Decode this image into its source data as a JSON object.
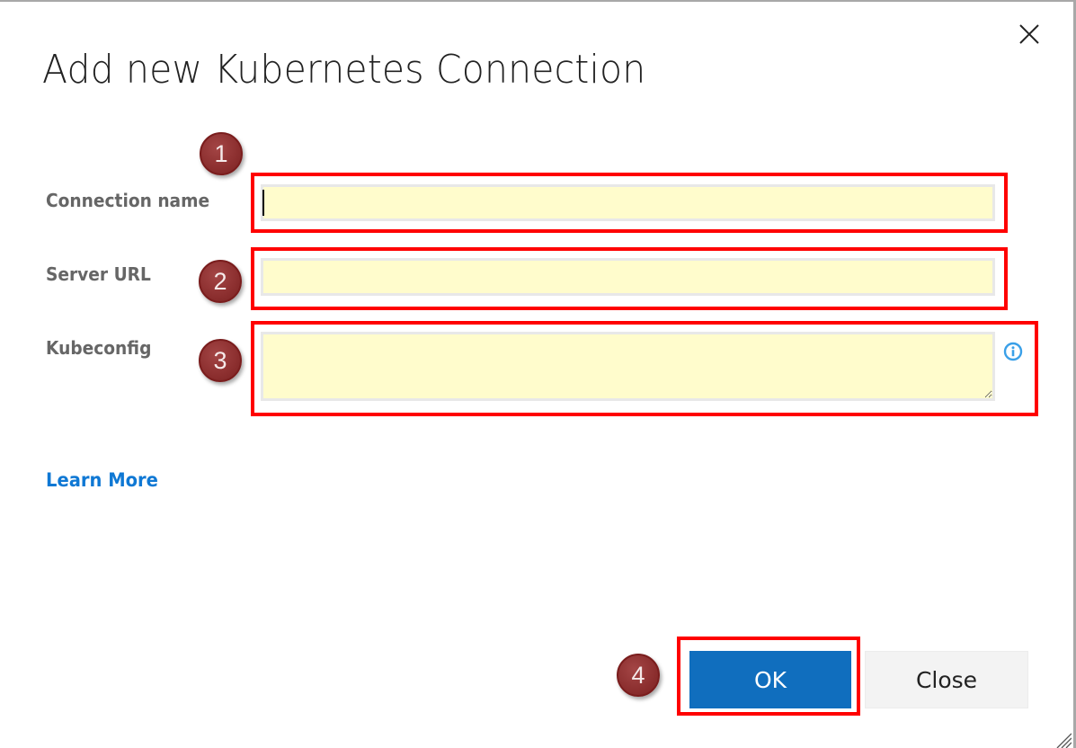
{
  "dialog": {
    "title": "Add new Kubernetes Connection",
    "close_icon": "close-x-icon"
  },
  "form": {
    "fields": [
      {
        "label": "Connection name",
        "value": "",
        "placeholder": "",
        "step": "1",
        "focused": true
      },
      {
        "label": "Server URL",
        "value": "",
        "placeholder": "",
        "step": "2"
      },
      {
        "label": "Kubeconfig",
        "value": "",
        "placeholder": "",
        "step": "3",
        "info_icon": "info-circle-icon"
      }
    ],
    "learn_more": "Learn More"
  },
  "footer": {
    "ok_label": "OK",
    "ok_step": "4",
    "close_label": "Close"
  },
  "colors": {
    "primary": "#106ebe",
    "link": "#0f78d4",
    "highlight": "#ff0000",
    "field_bg": "#fffccc",
    "badge": "#8c2f2f"
  }
}
